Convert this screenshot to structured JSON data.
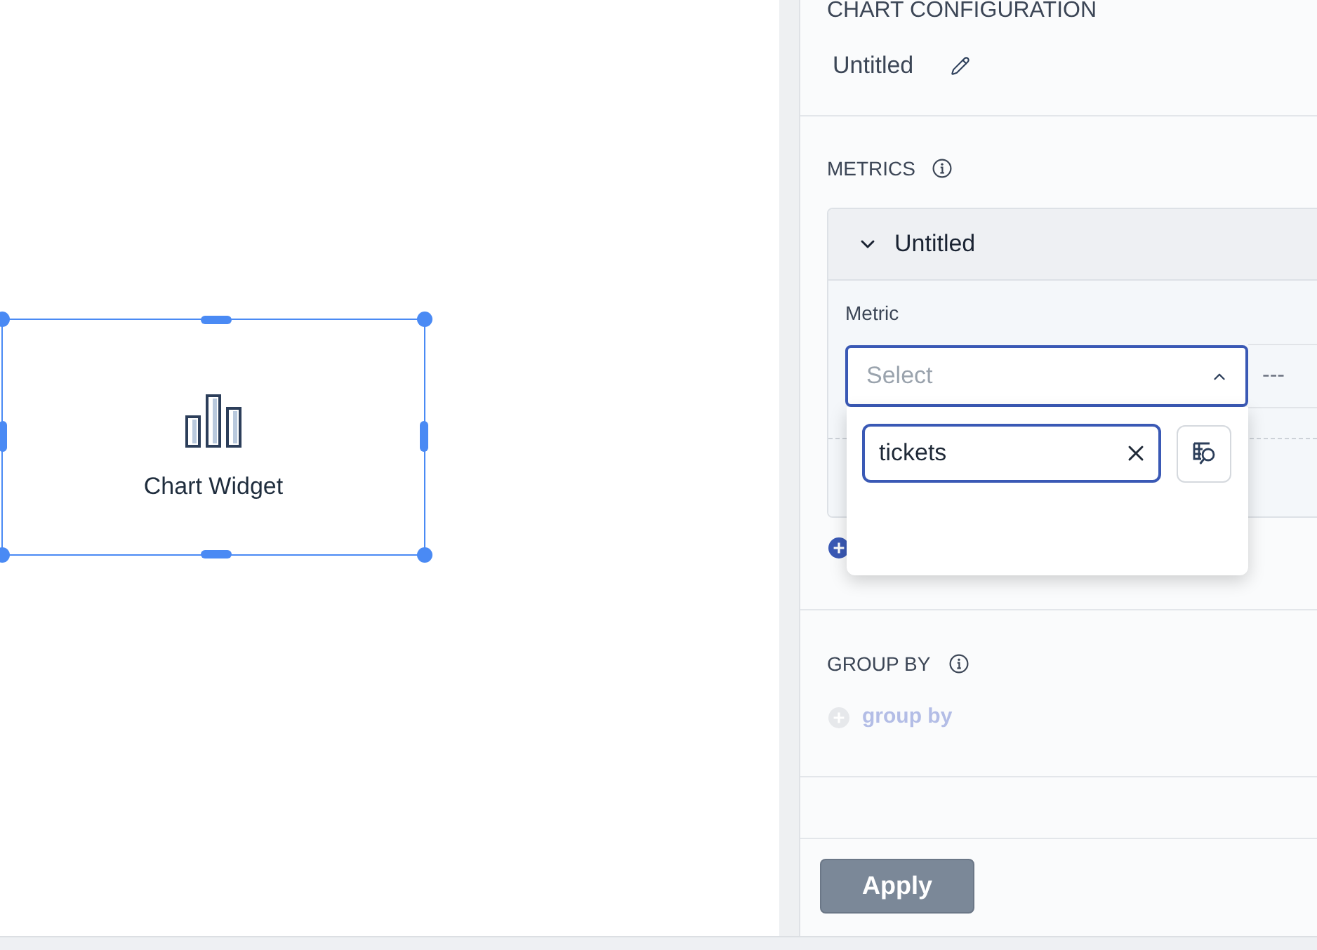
{
  "canvas": {
    "widget": {
      "label": "Chart Widget",
      "selected": true
    }
  },
  "panel": {
    "title": "CHART CONFIGURATION",
    "chart_name": "Untitled",
    "metrics": {
      "heading": "METRICS",
      "items": [
        {
          "title": "Untitled",
          "expanded": true,
          "field_label": "Metric",
          "select": {
            "placeholder": "Select",
            "open": true,
            "search": "tickets"
          },
          "aggregation": "---"
        }
      ]
    },
    "group_by": {
      "heading": "GROUP BY",
      "add_label": "group by",
      "disabled": true
    },
    "apply_button": {
      "label": "Apply",
      "disabled": true
    }
  }
}
